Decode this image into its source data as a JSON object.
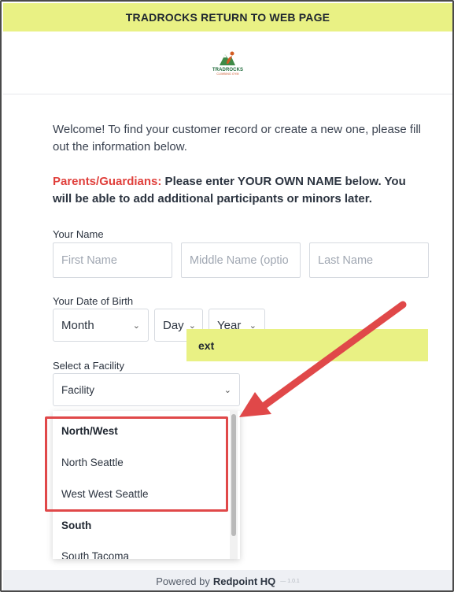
{
  "topbar": {
    "label": "TRADROCKS RETURN TO WEB PAGE"
  },
  "logo": {
    "name": "TRADROCKS",
    "sub": "CLIMBING GYM"
  },
  "welcome": "Welcome! To find your customer record or create a new one, please fill out the information below.",
  "notice": {
    "prefix": "Parents/Guardians:",
    "body": " Please enter YOUR OWN NAME below. You will be able to add additional participants or minors later."
  },
  "name_section": {
    "label": "Your Name",
    "first_placeholder": "First Name",
    "middle_placeholder": "Middle Name (optio",
    "last_placeholder": "Last Name"
  },
  "dob_section": {
    "label": "Your Date of Birth",
    "month": "Month",
    "day": "Day",
    "year": "Year"
  },
  "facility_section": {
    "label": "Select a Facility",
    "selected": "Facility"
  },
  "next_button": {
    "label": "ext"
  },
  "dropdown": {
    "groups": [
      {
        "label": "North/West",
        "options": [
          "North Seattle",
          "West West Seattle"
        ]
      },
      {
        "label": "South",
        "options": [
          "South Tacoma"
        ]
      }
    ]
  },
  "footer": {
    "prefix": "Powered by",
    "brand": "Redpoint HQ",
    "version": "— 1.0.1"
  },
  "colors": {
    "accent_yellow": "#e9f184",
    "alert_red": "#e0403c",
    "annotation_red": "#e04849"
  },
  "icons": {
    "chevron": "chevron-down-icon",
    "logo": "mountain-logo-icon",
    "arrow": "annotation-arrow"
  }
}
